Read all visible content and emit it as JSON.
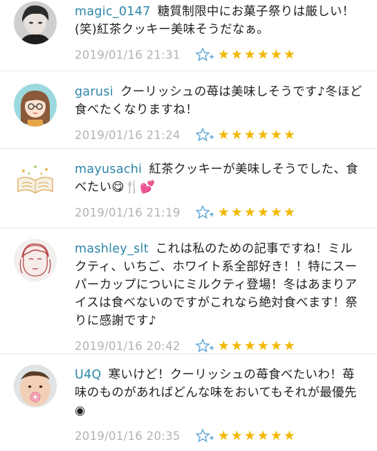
{
  "comments": [
    {
      "user": "magic_0147",
      "text": "糖質制限中にお菓子祭りは厳しい！(笑)紅茶クッキー美味そうだなぁ。",
      "date": "2019/01/16 21:31",
      "stars": "★★★★★★",
      "avatar": "avatar-photo-man"
    },
    {
      "user": "garusi",
      "text": "クーリッシュの苺は美味しそうです♪冬ほど食べたくなりますね！",
      "date": "2019/01/16 21:24",
      "stars": "★★★★★★",
      "avatar": "avatar-cartoon-girl"
    },
    {
      "user": "mayusachi",
      "text": "紅茶クッキーが美味しそうでした、食べたい😋🍴💕",
      "date": "2019/01/16 21:19",
      "stars": "★★★★★★",
      "avatar": "avatar-open-book"
    },
    {
      "user": "mashley_slt",
      "text": "これは私のための記事ですね！ミルクティ、いちご、ホワイト系全部好き！！特にスーパーカップについにミルクティ登場！冬はあまりアイスは食べないのですがこれなら絶対食べます！祭りに感謝です♪",
      "date": "2019/01/16 20:42",
      "stars": "★★★★★★",
      "avatar": "avatar-sketch-face"
    },
    {
      "user": "U4Q",
      "text": "寒いけど！クーリッシュの苺食べたいわ！苺味のものがあればどんな味をおいてもそれが最優先◉",
      "date": "2019/01/16 20:35",
      "stars": "★★★★★★",
      "avatar": "avatar-photo-baby"
    }
  ]
}
